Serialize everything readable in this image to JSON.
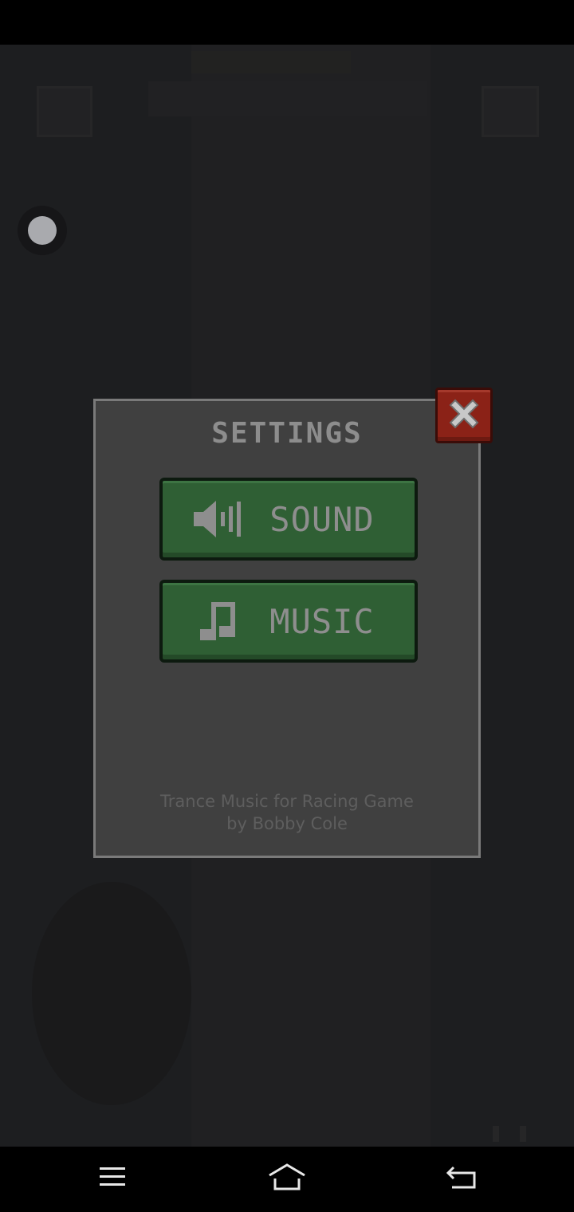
{
  "dialog": {
    "title": "SETTINGS",
    "sound_label": "SOUND",
    "music_label": "MUSIC",
    "credits_line1": "Trance Music for Racing Game",
    "credits_line2": "by Bobby Cole"
  },
  "icons": {
    "sound": "speaker-icon",
    "music": "music-note-icon",
    "close": "close-icon",
    "nav_menu": "menu-icon",
    "nav_home": "home-icon",
    "nav_back": "back-icon"
  },
  "colors": {
    "button_green": "#2f5f34",
    "close_red": "#8b2217",
    "dialog_bg": "#404040",
    "overlay_bg": "#1d1e20"
  }
}
